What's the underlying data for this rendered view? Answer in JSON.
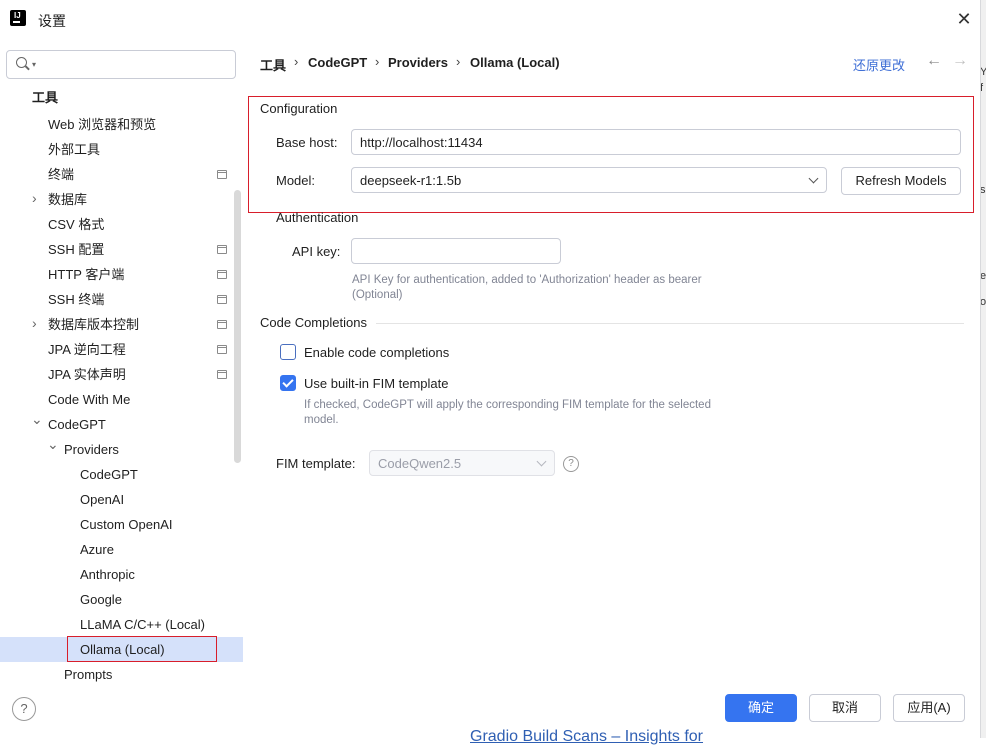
{
  "window": {
    "title": "设置",
    "close_glyph": "✕"
  },
  "search": {
    "placeholder": "",
    "dropdown_glyph": "▾"
  },
  "sidebar": {
    "items": [
      {
        "label": "工具"
      },
      {
        "label": "Web 浏览器和预览"
      },
      {
        "label": "外部工具"
      },
      {
        "label": "终端"
      },
      {
        "label": "数据库"
      },
      {
        "label": "CSV 格式"
      },
      {
        "label": "SSH 配置"
      },
      {
        "label": "HTTP 客户端"
      },
      {
        "label": "SSH 终端"
      },
      {
        "label": "数据库版本控制"
      },
      {
        "label": "JPA 逆向工程"
      },
      {
        "label": "JPA 实体声明"
      },
      {
        "label": "Code With Me"
      },
      {
        "label": "CodeGPT"
      },
      {
        "label": "Providers"
      },
      {
        "label": "CodeGPT"
      },
      {
        "label": "OpenAI"
      },
      {
        "label": "Custom OpenAI"
      },
      {
        "label": "Azure"
      },
      {
        "label": "Anthropic"
      },
      {
        "label": "Google"
      },
      {
        "label": "LLaMA C/C++ (Local)"
      },
      {
        "label": "Ollama (Local)"
      },
      {
        "label": "Prompts"
      }
    ],
    "selected": "Ollama (Local)",
    "expand_glyph": "›",
    "collapse_glyph": "⌄"
  },
  "breadcrumb": {
    "items": [
      "工具",
      "CodeGPT",
      "Providers",
      "Ollama (Local)"
    ],
    "separator": "›"
  },
  "header": {
    "reset_label": "还原更改",
    "back_glyph": "←",
    "forward_glyph": "→"
  },
  "configuration": {
    "title": "Configuration",
    "base_host_label": "Base host:",
    "base_host_value": "http://localhost:11434",
    "model_label": "Model:",
    "model_value": "deepseek-r1:1.5b",
    "refresh_label": "Refresh Models"
  },
  "authentication": {
    "title": "Authentication",
    "api_key_label": "API key:",
    "api_key_value": "",
    "hint": "API Key for authentication, added to 'Authorization' header as bearer (Optional)"
  },
  "completions": {
    "title": "Code Completions",
    "enable_label": "Enable code completions",
    "enable_checked": false,
    "fim_label": "Use built-in FIM template",
    "fim_checked": true,
    "fim_hint": "If checked, CodeGPT will apply the corresponding FIM template for the selected model.",
    "template_label": "FIM template:",
    "template_value": "CodeQwen2.5",
    "help_glyph": "?"
  },
  "footer": {
    "ok_label": "确定",
    "cancel_label": "取消",
    "apply_label": "应用(A)",
    "help_glyph": "?"
  },
  "background": {
    "snippet": "Gradio Build Scans – Insights for",
    "edge_chars": [
      "Y",
      "f",
      "s",
      "e",
      "o"
    ]
  },
  "colors": {
    "accent": "#3574f0",
    "highlight": "#d81e2b",
    "selection": "#d5e1fa",
    "link": "#3f6fd6"
  }
}
